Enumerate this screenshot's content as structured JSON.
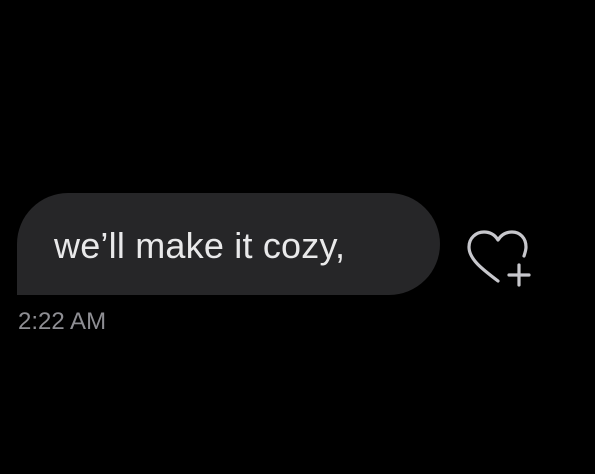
{
  "conversation": {
    "messages": [
      {
        "text": "we’ll make it cozy,",
        "time": "2:22 AM"
      }
    ]
  },
  "actions": {
    "react_icon": "heart-plus-icon"
  },
  "colors": {
    "background": "#000000",
    "bubble": "#262628",
    "message_text": "#e9e9ea",
    "timestamp": "#8e8e93",
    "icon": "#c7c7cc"
  }
}
